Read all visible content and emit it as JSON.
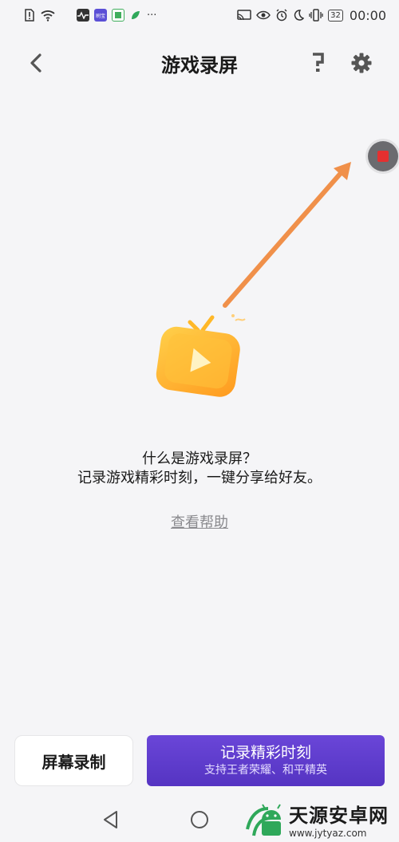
{
  "status_bar": {
    "time": "00:00",
    "battery": "32",
    "more": "···",
    "app_icons": [
      {
        "name": "activity-app-icon",
        "color": "#333333",
        "label": ""
      },
      {
        "name": "app-badge-icon",
        "color": "#5b4fd6",
        "label": "刷宝"
      },
      {
        "name": "calendar-app-icon",
        "color": "#3fae5c",
        "label": ""
      },
      {
        "name": "leaf-app-icon",
        "color": "#2fa85a",
        "label": ""
      }
    ]
  },
  "header": {
    "title": "游戏录屏"
  },
  "intro": {
    "title": "什么是游戏录屏？",
    "description": "记录游戏精彩时刻，一键分享给好友。",
    "help_link": "查看帮助"
  },
  "actions": {
    "screen_record_label": "屏幕录制",
    "record_moment_label": "记录精彩时刻",
    "record_moment_sub": "支持王者荣耀、和平精英"
  },
  "watermark": {
    "main": "天源安卓网",
    "url": "www.jytyaz.com"
  },
  "colors": {
    "accent": "#5534c2",
    "arrow": "#f0904a",
    "illustration": "#ffb020",
    "record_stop": "#e53030"
  }
}
